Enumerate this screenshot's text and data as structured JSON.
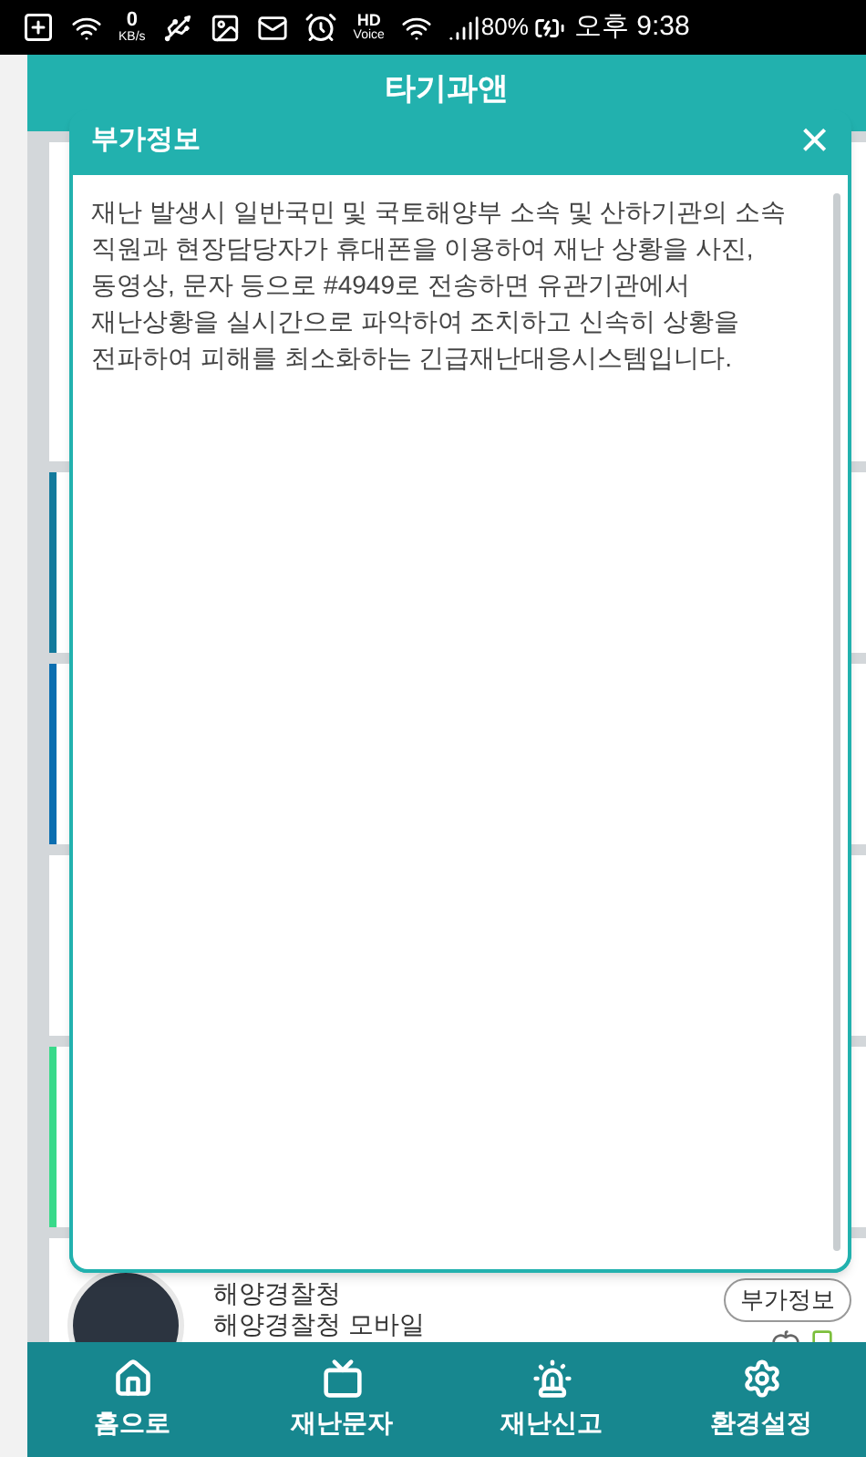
{
  "status_bar": {
    "speed_value": "0",
    "speed_unit": "KB/s",
    "hd_label": "HD",
    "voice_label": "Voice",
    "battery": "80%",
    "time": "오후 9:38"
  },
  "app_bar": {
    "title": "타기과앤"
  },
  "list_items": [
    {
      "name": "해양경찰청",
      "subtitle": "해양경찰청 모바일",
      "button": "부가정보"
    }
  ],
  "dialog": {
    "title": "부가정보",
    "close": "×",
    "body": "재난 발생시 일반국민 및 국토해양부 소속 및 산하기관의 소속 직원과 현장담당자가 휴대폰을 이용하여 재난 상황을 사진, 동영상, 문자 등으로 #4949로 전송하면 유관기관에서 재난상황을 실시간으로 파악하여 조치하고 신속히 상황을 전파하여 피해를 최소화하는 긴급재난대응시스템입니다."
  },
  "nav": [
    {
      "kind": "home",
      "label": "홈으로"
    },
    {
      "kind": "tv",
      "label": "재난문자"
    },
    {
      "kind": "siren",
      "label": "재난신고"
    },
    {
      "kind": "settings",
      "label": "환경설정"
    }
  ]
}
